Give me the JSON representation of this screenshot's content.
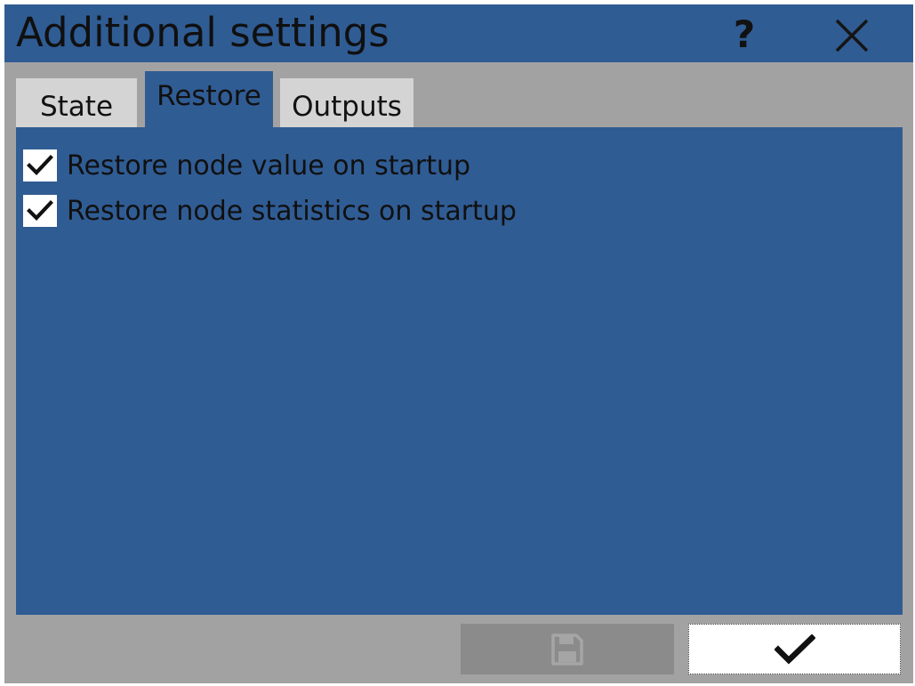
{
  "window": {
    "title": "Additional settings",
    "help_label": "?"
  },
  "tabs": [
    {
      "label": "State",
      "active": false
    },
    {
      "label": "Restore",
      "active": true
    },
    {
      "label": "Outputs",
      "active": false
    }
  ],
  "restore": {
    "options": [
      {
        "label": "Restore node value on startup",
        "checked": true
      },
      {
        "label": "Restore node statistics on startup",
        "checked": true
      }
    ]
  },
  "footer": {
    "save_icon": "save-icon",
    "save_enabled": false,
    "ok_icon": "checkmark-icon"
  },
  "colors": {
    "accent": "#305c94",
    "dialog_bg": "#a3a2a3",
    "tab_inactive": "#d4d4d4",
    "disabled_button": "#8c8b8c"
  }
}
